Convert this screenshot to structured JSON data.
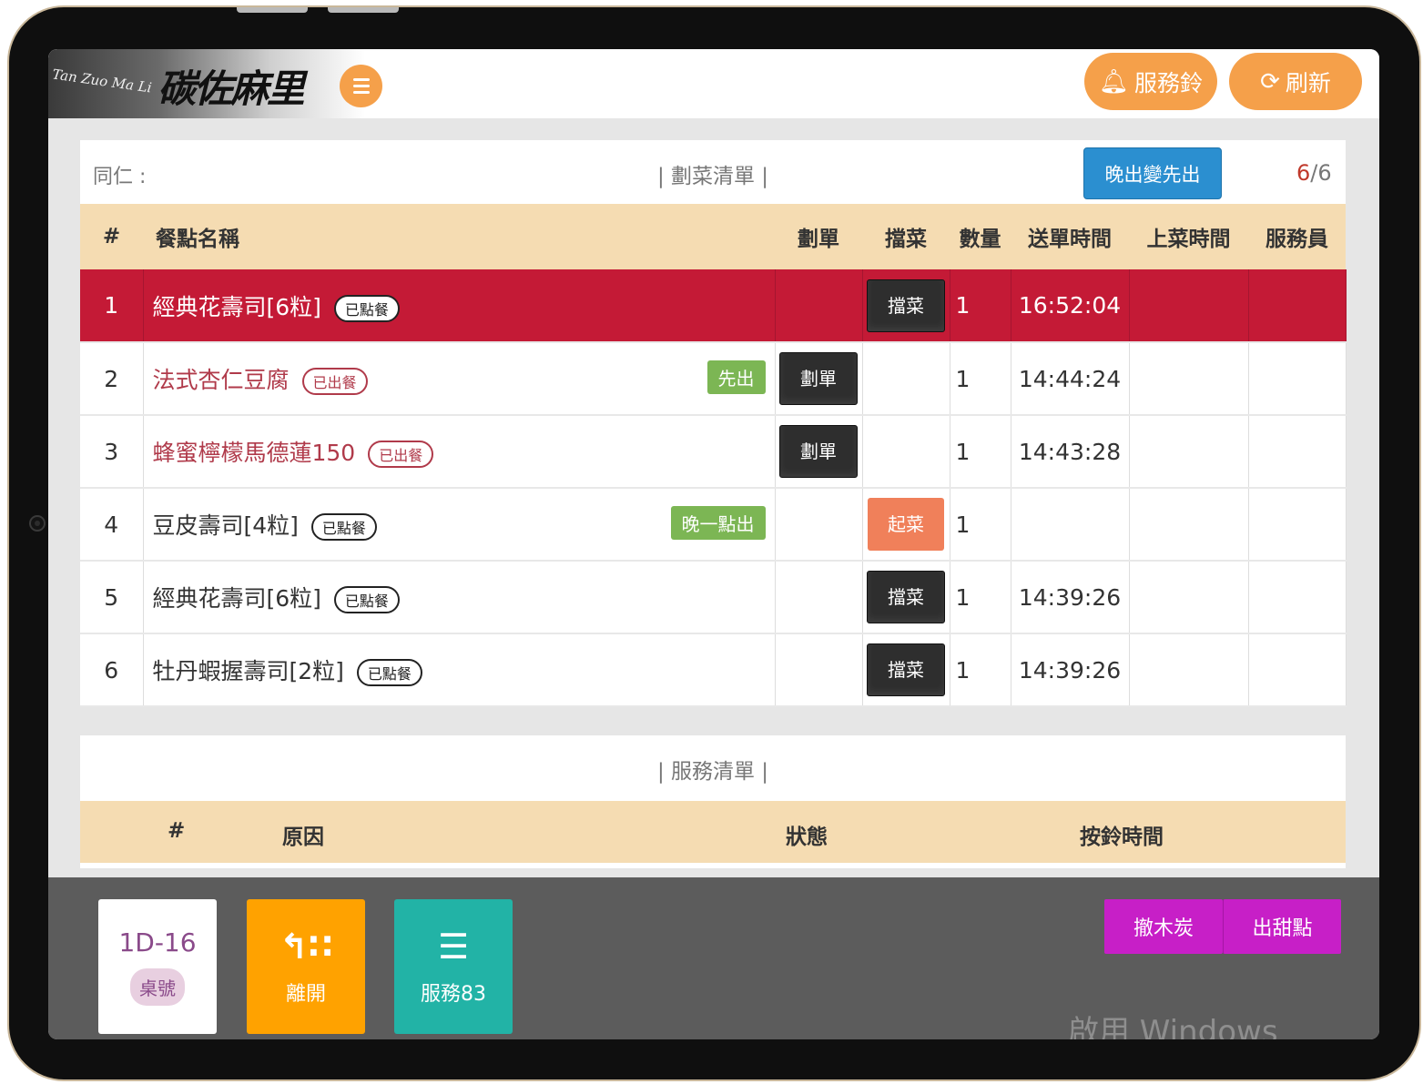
{
  "header": {
    "logo_sub": "Tan Zuo Ma Li",
    "logo_main": "碳佐麻里",
    "bell_label": "服務鈴",
    "refresh_label": "刷新"
  },
  "order_panel": {
    "staff_label": "同仁 :",
    "title": "| 劃菜清單 |",
    "late_first_button": "晚出變先出",
    "count_current": "6",
    "count_total": "/6",
    "columns": [
      "#",
      "餐點名稱",
      "劃單",
      "擋菜",
      "數量",
      "送單時間",
      "上菜時間",
      "服務員"
    ],
    "rows": [
      {
        "num": "1",
        "name": "經典花壽司[6粒]",
        "tag": "已點餐",
        "mark": "",
        "cut_btn": "",
        "action_btn": "擋菜",
        "qty": "1",
        "send_time": "16:52:04",
        "serve_time": "",
        "server": ""
      },
      {
        "num": "2",
        "name": "法式杏仁豆腐",
        "tag": "已出餐",
        "mark": "先出",
        "cut_btn": "劃單",
        "action_btn": "",
        "qty": "1",
        "send_time": "14:44:24",
        "serve_time": "",
        "server": ""
      },
      {
        "num": "3",
        "name": "蜂蜜檸檬馬德蓮150",
        "tag": "已出餐",
        "mark": "",
        "cut_btn": "劃單",
        "action_btn": "",
        "qty": "1",
        "send_time": "14:43:28",
        "serve_time": "",
        "server": ""
      },
      {
        "num": "4",
        "name": "豆皮壽司[4粒]",
        "tag": "已點餐",
        "mark": "晚一點出",
        "cut_btn": "",
        "action_btn": "起菜",
        "qty": "1",
        "send_time": "",
        "serve_time": "",
        "server": ""
      },
      {
        "num": "5",
        "name": "經典花壽司[6粒]",
        "tag": "已點餐",
        "mark": "",
        "cut_btn": "",
        "action_btn": "擋菜",
        "qty": "1",
        "send_time": "14:39:26",
        "serve_time": "",
        "server": ""
      },
      {
        "num": "6",
        "name": "牡丹蝦握壽司[2粒]",
        "tag": "已點餐",
        "mark": "",
        "cut_btn": "",
        "action_btn": "擋菜",
        "qty": "1",
        "send_time": "14:39:26",
        "serve_time": "",
        "server": ""
      }
    ]
  },
  "service_panel": {
    "title": "| 服務清單 |",
    "columns": [
      "#",
      "原因",
      "狀態",
      "按鈴時間"
    ]
  },
  "footer": {
    "table_no": "1D-16",
    "table_label": "桌號",
    "leave_label": "離開",
    "service_label": "服務83",
    "charcoal_label": "撤木炭",
    "dessert_label": "出甜點"
  },
  "watermark": "啟用 Windows",
  "colors": {
    "accent_orange": "#f5a04a",
    "highlight_row": "#c41a36",
    "table_header": "#f5dcb2",
    "blue_button": "#2b8fd0",
    "purple_button": "#c71fc7",
    "leave_tile": "#ffa200",
    "service_tile": "#22b3a6"
  }
}
